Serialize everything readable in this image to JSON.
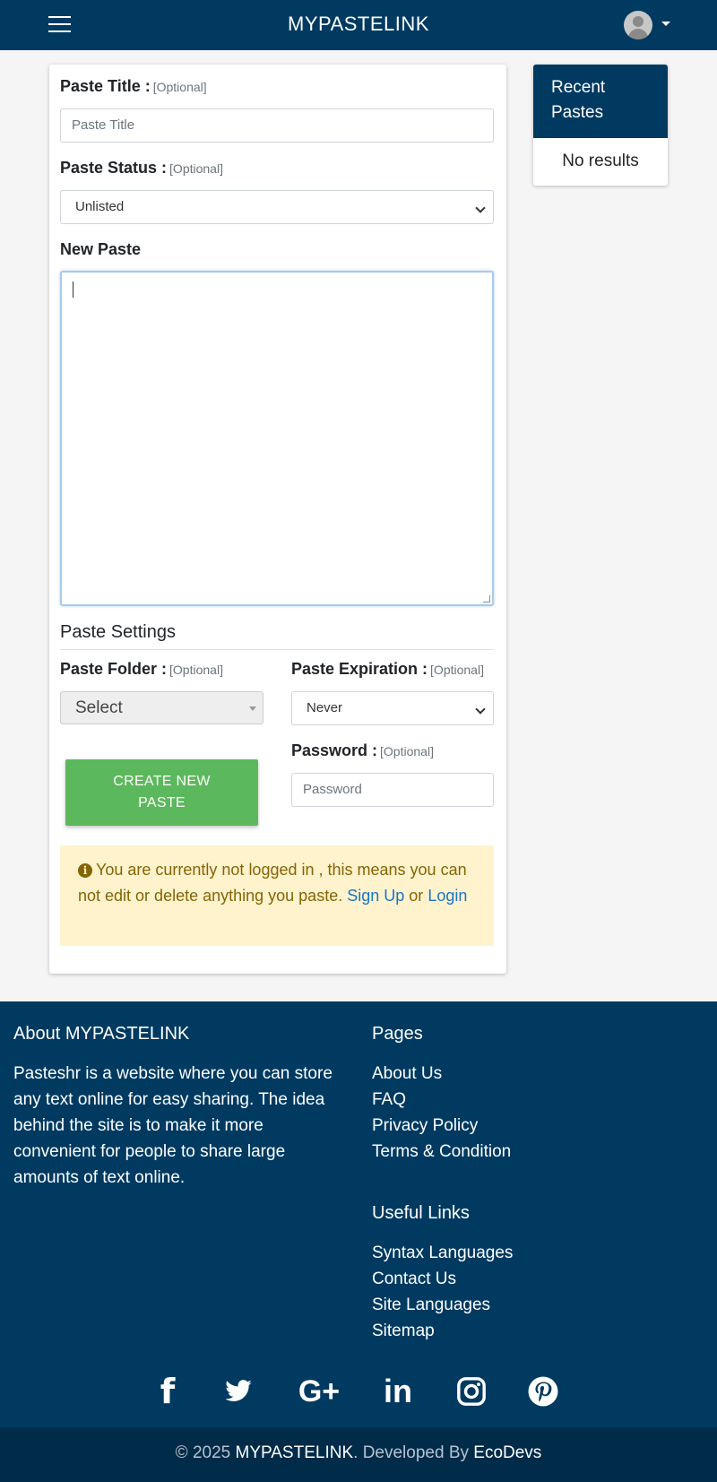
{
  "navbar": {
    "brand": "MYPASTELINK",
    "menu_icon": "hamburger-icon",
    "avatar_icon": "user-avatar-icon"
  },
  "form": {
    "title_label": "Paste Title :",
    "title_optional": "[Optional]",
    "title_placeholder": "Paste Title",
    "status_label": "Paste Status :",
    "status_optional": "[Optional]",
    "status_selected": "Unlisted",
    "new_paste_label": "New Paste",
    "settings_title": "Paste Settings",
    "folder_label": "Paste Folder :",
    "folder_optional": "[Optional]",
    "folder_selected": "Select",
    "expiration_label": "Paste Expiration :",
    "expiration_optional": "[Optional]",
    "expiration_selected": "Never",
    "password_label": "Password :",
    "password_optional": "[Optional]",
    "password_placeholder": "Password",
    "create_button_line1": "CREATE NEW",
    "create_button_line2": "PASTE"
  },
  "alert": {
    "text": "You are currently not logged in , this means you can not edit or delete anything you paste.",
    "signup": "Sign Up",
    "or": "or",
    "login": "Login"
  },
  "recent": {
    "title": "Recent Pastes",
    "empty": "No results"
  },
  "footer": {
    "about_title": "About MYPASTELINK",
    "about_text": "Pasteshr is a website where you can store any text online for easy sharing. The idea behind the site is to make it more convenient for people to share large amounts of text online.",
    "pages_title": "Pages",
    "pages": [
      "About Us",
      "FAQ",
      "Privacy Policy",
      "Terms & Condition"
    ],
    "useful_title": "Useful Links",
    "useful": [
      "Syntax Languages",
      "Contact Us",
      "Site Languages",
      "Sitemap"
    ],
    "socials": [
      "facebook-icon",
      "twitter-icon",
      "google-plus-icon",
      "linkedin-icon",
      "instagram-icon",
      "pinterest-icon"
    ]
  },
  "copyright": {
    "prefix": "© 2025",
    "brand": "MYPASTELINK",
    "middle": ". Developed By",
    "dev": "EcoDevs"
  },
  "colors": {
    "primary": "#003a61",
    "success": "#5cb85c",
    "alert_bg": "#fff3cd",
    "link": "#1a73c7"
  }
}
